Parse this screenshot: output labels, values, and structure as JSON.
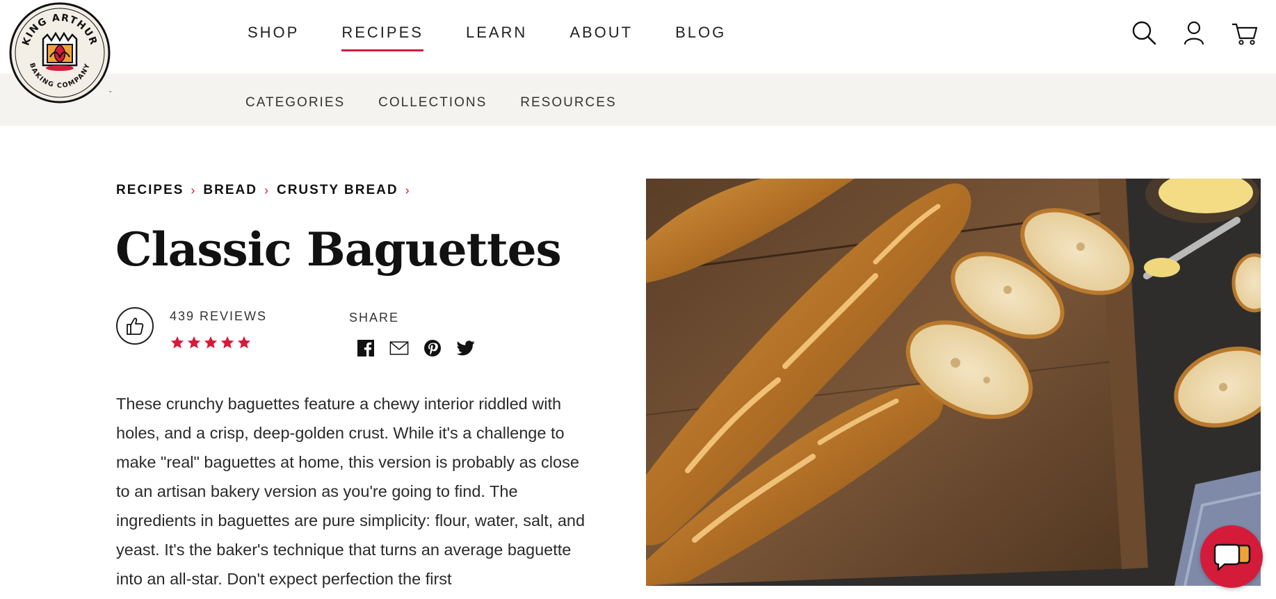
{
  "logo": {
    "arc_top": "KING ARTHUR",
    "arc_bottom": "BAKING COMPANY",
    "trademark": "™"
  },
  "nav": {
    "items": [
      {
        "label": "SHOP"
      },
      {
        "label": "RECIPES",
        "active": true
      },
      {
        "label": "LEARN"
      },
      {
        "label": "ABOUT"
      },
      {
        "label": "BLOG"
      }
    ],
    "active_color": "#d41c3a"
  },
  "header_icons": [
    "search-icon",
    "account-icon",
    "cart-icon"
  ],
  "subnav": {
    "items": [
      {
        "label": "CATEGORIES"
      },
      {
        "label": "COLLECTIONS"
      },
      {
        "label": "RESOURCES"
      }
    ]
  },
  "breadcrumb": [
    {
      "label": "RECIPES"
    },
    {
      "label": "BREAD"
    },
    {
      "label": "CRUSTY BREAD"
    }
  ],
  "recipe": {
    "title": "Classic Baguettes",
    "reviews_label": "439 REVIEWS",
    "rating": 5,
    "share_label": "SHARE",
    "share_icons": [
      "facebook-icon",
      "email-icon",
      "pinterest-icon",
      "twitter-icon"
    ],
    "description": "These crunchy baguettes feature a chewy interior riddled with holes, and a crisp, deep-golden crust. While it's a challenge to make \"real\" baguettes at home, this version is probably as close to an artisan bakery version as you're going to find. The ingredients in baguettes are pure simplicity: flour, water, salt, and yeast. It's the baker's technique that turns an average baguette into an all-star. Don't expect perfection the first"
  },
  "colors": {
    "accent": "#d41c3a",
    "subbar_bg": "#f5f3ef",
    "text": "#1a1a1a"
  }
}
